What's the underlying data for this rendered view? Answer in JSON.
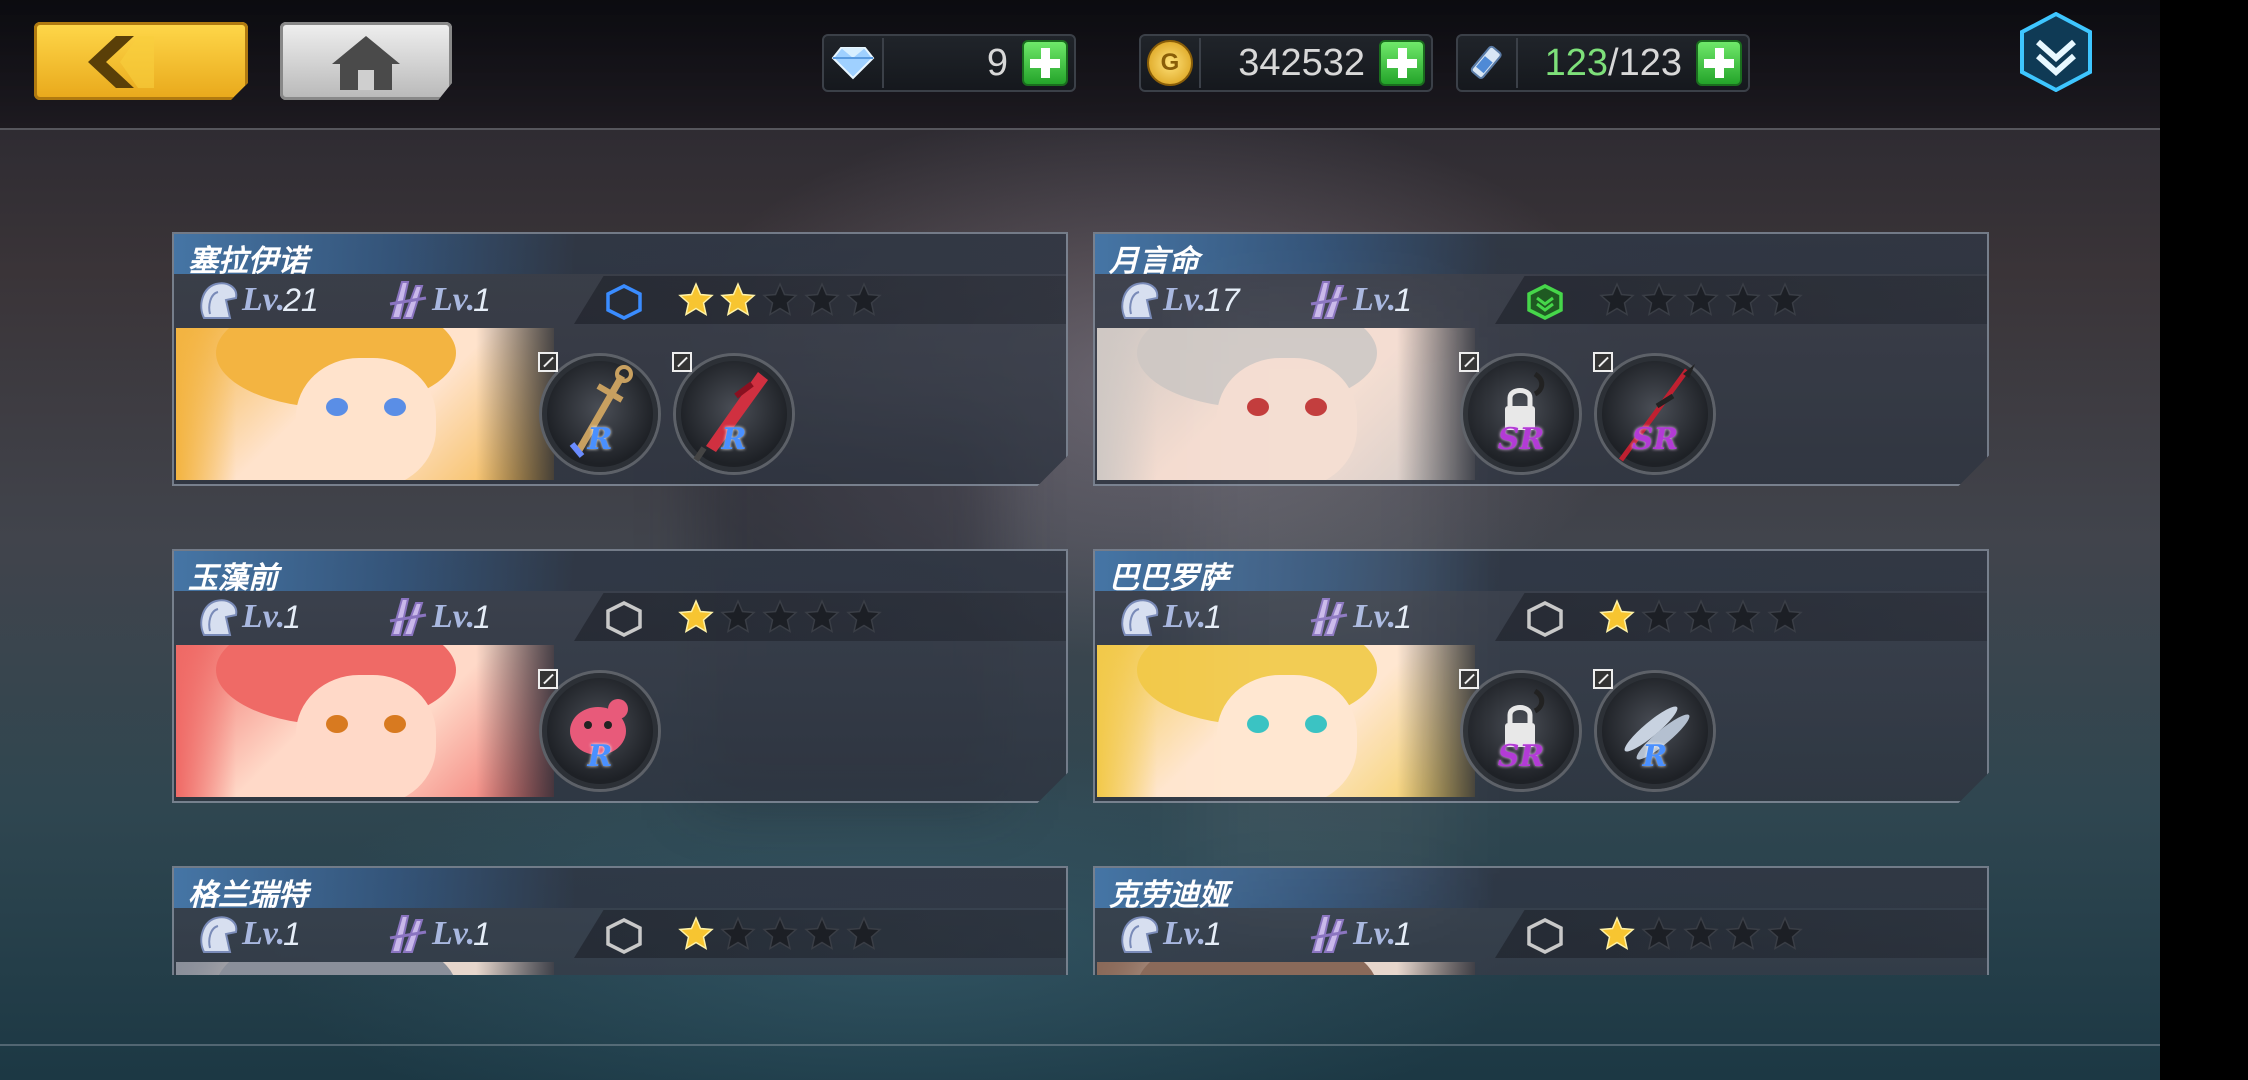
{
  "resources": {
    "diamonds": "9",
    "gold": "342532",
    "stamina_current": "123",
    "stamina_sep_max": "/123"
  },
  "colors": {
    "accent_yellow": "#f2c12e",
    "star_lit": "#f7c531",
    "star_dim": "#1c1f25",
    "rarity_R": "#4a90ff",
    "rarity_SR": "#b33bd6",
    "stamina_green": "#7ee07a"
  },
  "level_label": "Lv.",
  "characters": [
    {
      "name": "塞拉伊诺",
      "level": "21",
      "weapon_level": "1",
      "rank_color": "#3a8cff",
      "stars": 2,
      "equipment": [
        {
          "rarity": "R",
          "item": "anchor"
        },
        {
          "rarity": "R",
          "item": "blade"
        }
      ]
    },
    {
      "name": "月言命",
      "level": "17",
      "weapon_level": "1",
      "rank_color": "#46d64a",
      "stars": 0,
      "equipment": [
        {
          "rarity": "SR",
          "item": "locked"
        },
        {
          "rarity": "SR",
          "item": "spear"
        }
      ]
    },
    {
      "name": "玉藻前",
      "level": "1",
      "weapon_level": "1",
      "rank_color": "#c9c9c9",
      "stars": 1,
      "equipment": [
        {
          "rarity": "R",
          "item": "pet"
        }
      ]
    },
    {
      "name": "巴巴罗萨",
      "level": "1",
      "weapon_level": "1",
      "rank_color": "#c9c9c9",
      "stars": 1,
      "equipment": [
        {
          "rarity": "SR",
          "item": "locked"
        },
        {
          "rarity": "R",
          "item": "fish"
        }
      ]
    },
    {
      "name": "格兰瑞特",
      "level": "1",
      "weapon_level": "1",
      "rank_color": "#c9c9c9",
      "stars": 1,
      "equipment": []
    },
    {
      "name": "克劳迪娅",
      "level": "1",
      "weapon_level": "1",
      "rank_color": "#c9c9c9",
      "stars": 1,
      "equipment": []
    }
  ]
}
